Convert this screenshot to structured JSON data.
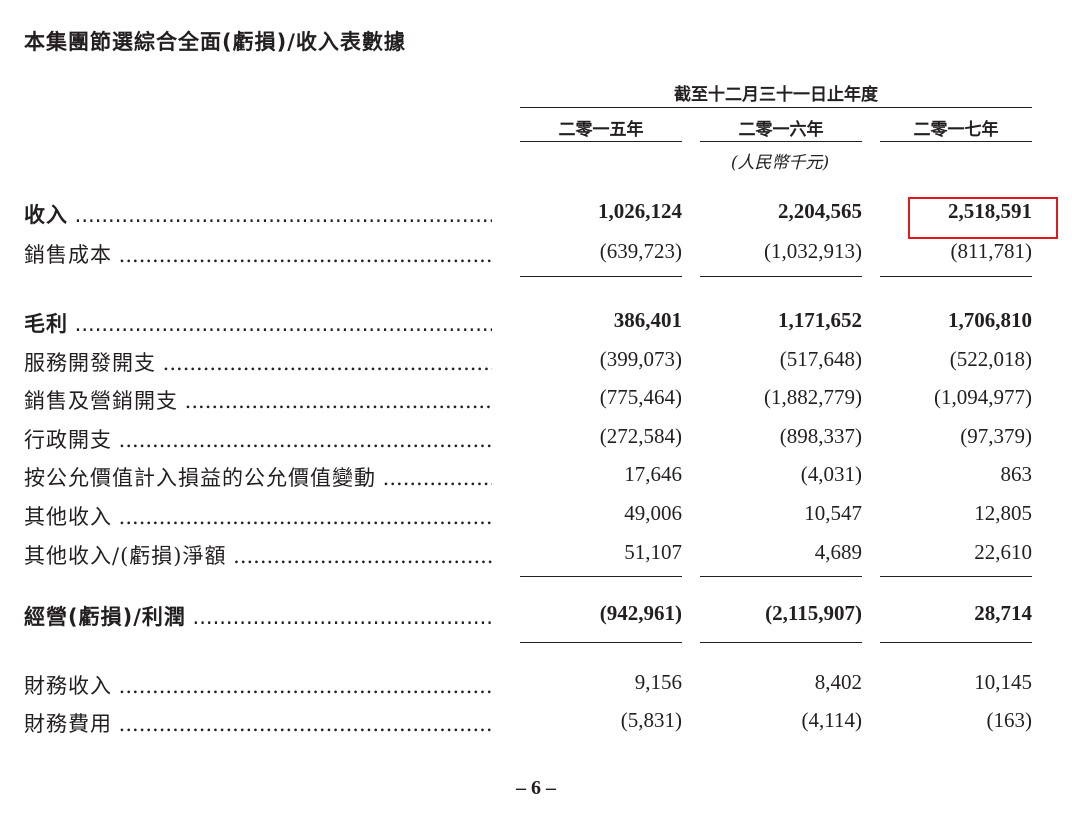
{
  "document": {
    "title": "本集團節選綜合全面(虧損)/收入表數據",
    "period_header": "截至十二月三十一日止年度",
    "years": [
      "二零一五年",
      "二零一六年",
      "二零一七年"
    ],
    "unit": "(人民幣千元)",
    "page_number": "– 6 –"
  },
  "rows": [
    {
      "label": "收入",
      "values": [
        "1,026,124",
        "2,204,565",
        "2,518,591"
      ],
      "bold": true
    },
    {
      "label": "銷售成本",
      "values": [
        "(639,723)",
        "(1,032,913)",
        "(811,781)"
      ],
      "bold": false
    },
    {
      "label": "毛利",
      "values": [
        "386,401",
        "1,171,652",
        "1,706,810"
      ],
      "bold": true
    },
    {
      "label": "服務開發開支",
      "values": [
        "(399,073)",
        "(517,648)",
        "(522,018)"
      ],
      "bold": false
    },
    {
      "label": "銷售及營銷開支",
      "values": [
        "(775,464)",
        "(1,882,779)",
        "(1,094,977)"
      ],
      "bold": false
    },
    {
      "label": "行政開支",
      "values": [
        "(272,584)",
        "(898,337)",
        "(97,379)"
      ],
      "bold": false
    },
    {
      "label": "按公允價值計入損益的公允價值變動",
      "values": [
        "17,646",
        "(4,031)",
        "863"
      ],
      "bold": false
    },
    {
      "label": "其他收入",
      "values": [
        "49,006",
        "10,547",
        "12,805"
      ],
      "bold": false
    },
    {
      "label": "其他收入/(虧損)淨額",
      "values": [
        "51,107",
        "4,689",
        "22,610"
      ],
      "bold": false
    },
    {
      "label": "經營(虧損)/利潤",
      "values": [
        "(942,961)",
        "(2,115,907)",
        "28,714"
      ],
      "bold": true
    },
    {
      "label": "財務收入",
      "values": [
        "9,156",
        "8,402",
        "10,145"
      ],
      "bold": false
    },
    {
      "label": "財務費用",
      "values": [
        "(5,831)",
        "(4,114)",
        "(163)"
      ],
      "bold": false
    }
  ],
  "colors": {
    "text": "#231f20",
    "highlight_border": "#e0191e"
  }
}
